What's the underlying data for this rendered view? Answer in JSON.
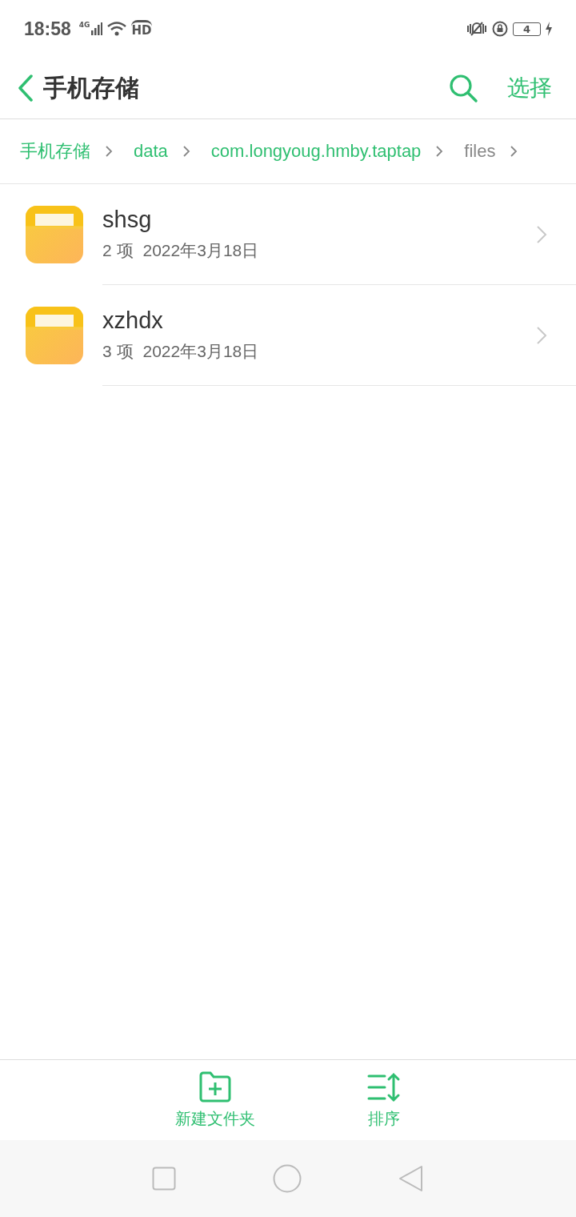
{
  "status_bar": {
    "time": "18:58",
    "network": "4G",
    "call_badge": "HD",
    "battery": "4"
  },
  "header": {
    "title": "手机存储",
    "action": "选择"
  },
  "breadcrumbs": [
    {
      "label": "手机存储",
      "selected": false
    },
    {
      "label": "data",
      "selected": false
    },
    {
      "label": "com.longyoug.hmby.taptap",
      "selected": false
    },
    {
      "label": "files",
      "selected": true
    }
  ],
  "items": [
    {
      "name": "shsg",
      "count": "2 项",
      "date": "2022年3月18日"
    },
    {
      "name": "xzhdx",
      "count": "3 项",
      "date": "2022年3月18日"
    }
  ],
  "toolbar": [
    {
      "kind": "new-folder",
      "label": "新建文件夹"
    },
    {
      "kind": "sort",
      "label": "排序"
    }
  ]
}
